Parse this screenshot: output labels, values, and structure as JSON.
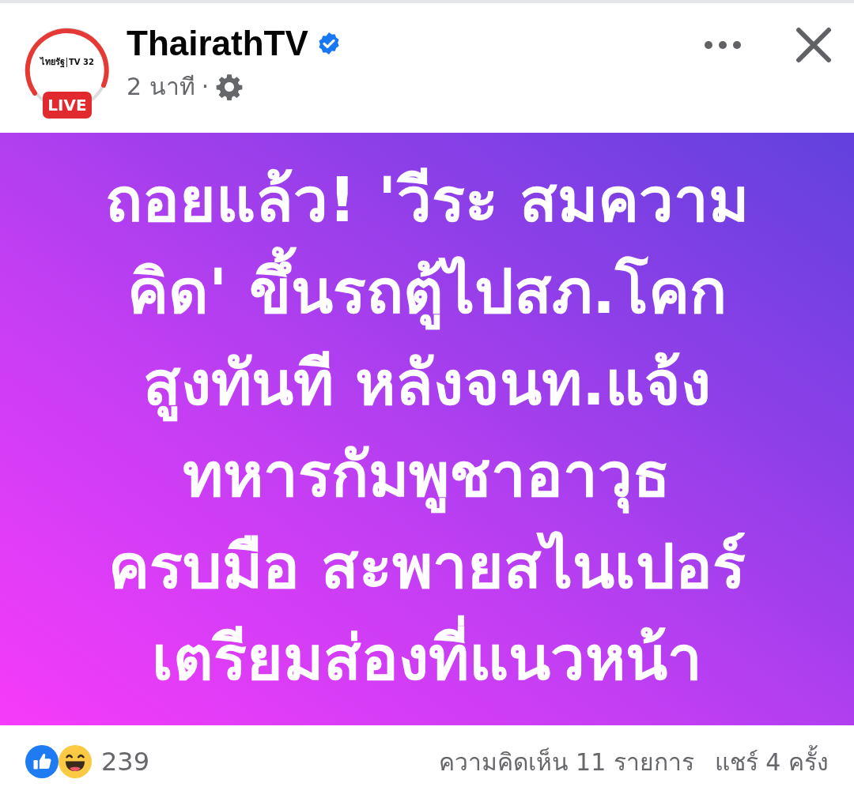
{
  "post": {
    "author": {
      "name": "ThairathTV",
      "verified": true,
      "avatar": {
        "logo_text": "ไทยรัฐ",
        "logo_channel": "TV 32",
        "badge": "LIVE"
      }
    },
    "time": "2 นาที",
    "separator": "·",
    "body": {
      "lines": [
        "ถอยแล้ว! 'วีระ สมความ",
        "คิด' ขึ้นรถตู้ไปสภ.โคก",
        "สูงทันที หลังจนท.แจ้ง",
        "ทหารกัมพูชาอาวุธ",
        "ครบมือ สะพายสไนเปอร์",
        "เตรียมส่องที่แนวหน้า"
      ]
    },
    "footer": {
      "reactions": [
        {
          "kind": "like"
        },
        {
          "kind": "haha"
        }
      ],
      "reaction_count": "239",
      "comments": "ความคิดเห็น 11 รายการ",
      "shares": "แชร์ 4 ครั้ง"
    }
  }
}
